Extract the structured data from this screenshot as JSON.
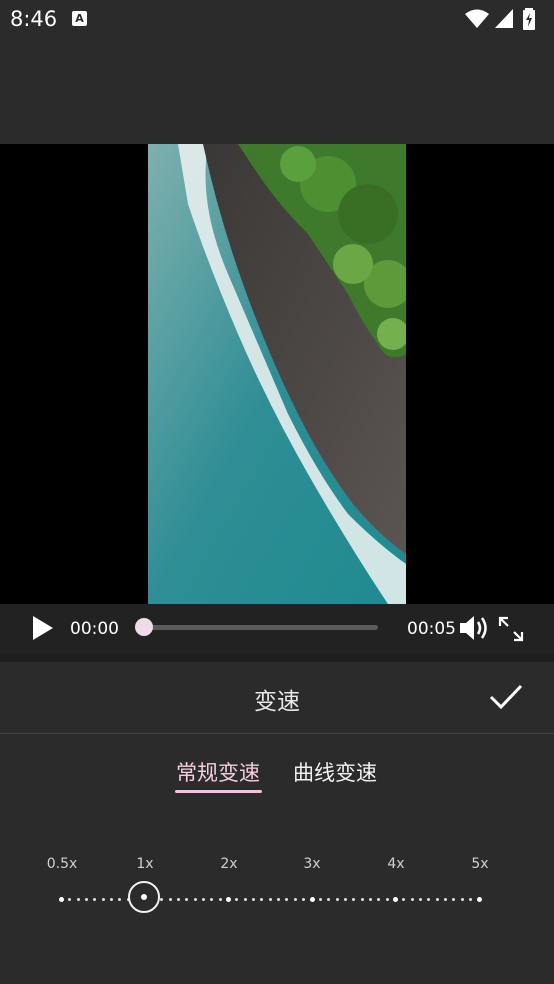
{
  "status_bar": {
    "time": "8:46",
    "notification_icon": "A"
  },
  "player": {
    "current_time": "00:00",
    "total_time": "00:05",
    "progress": 0.0
  },
  "panel": {
    "title": "变速",
    "tabs": [
      {
        "label": "常规变速",
        "active": true
      },
      {
        "label": "曲线变速",
        "active": false
      }
    ],
    "speed_labels": [
      "0.5x",
      "1x",
      "2x",
      "3x",
      "4x",
      "5x"
    ],
    "selected_speed": "1x"
  },
  "colors": {
    "accent": "#f0c5d9",
    "background": "#2b2b2b"
  },
  "icons": [
    "wifi-icon",
    "signal-icon",
    "battery-charging-icon",
    "play-icon",
    "volume-icon",
    "fullscreen-icon",
    "check-icon"
  ]
}
